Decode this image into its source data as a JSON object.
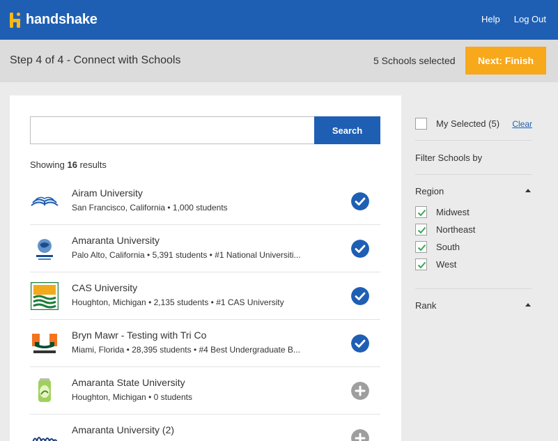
{
  "header": {
    "brand": "handshake",
    "nav": [
      "Help",
      "Log Out"
    ]
  },
  "step": {
    "title": "Step 4 of 4 - Connect with Schools",
    "selected_count": "5 Schools selected",
    "next_label": "Next: Finish"
  },
  "search": {
    "value": "",
    "placeholder": "",
    "button_label": "Search",
    "showing_prefix": "Showing",
    "showing_count": "16",
    "showing_suffix": "results"
  },
  "results": [
    {
      "name": "Airam University",
      "meta": "San Francisco, California • 1,000 students",
      "logo": "open-book-logo",
      "selected": true
    },
    {
      "name": "Amaranta University",
      "meta": "Palo Alto, California • 5,391 students • #1 National Universiti...",
      "logo": "globe-seal-logo",
      "selected": true
    },
    {
      "name": "CAS University",
      "meta": "Houghton, Michigan • 2,135 students • #1 CAS University",
      "logo": "sunrise-waves-logo",
      "selected": true
    },
    {
      "name": "Bryn Mawr - Testing with Tri Co",
      "meta": "Miami, Florida • 28,395 students • #4 Best Undergraduate B...",
      "logo": "u-miami-logo",
      "selected": true
    },
    {
      "name": "Amaranta State University",
      "meta": "Houghton, Michigan • 0 students",
      "logo": "soda-can-logo",
      "selected": false
    },
    {
      "name": "Amaranta University (2)",
      "meta": "",
      "logo": "berkeley-logo",
      "selected": false
    }
  ],
  "sidebar": {
    "my_selected": "My Selected (5)",
    "clear": "Clear",
    "filter_by": "Filter Schools by",
    "region_label": "Region",
    "regions": [
      {
        "label": "Midwest",
        "checked": true
      },
      {
        "label": "Northeast",
        "checked": true
      },
      {
        "label": "South",
        "checked": true
      },
      {
        "label": "West",
        "checked": true
      }
    ],
    "rank_label": "Rank"
  },
  "colors": {
    "brand_blue": "#1f5fb3",
    "accent_orange": "#f7a81b",
    "check_green": "#3aa757",
    "unselected_gray": "#9e9e9e"
  }
}
